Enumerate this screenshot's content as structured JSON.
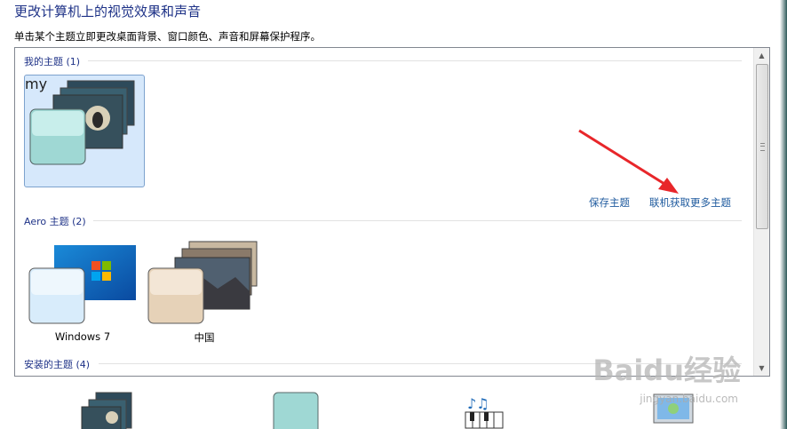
{
  "header": {
    "title": "更改计算机上的视觉效果和声音",
    "subtitle": "单击某个主题立即更改桌面背景、窗口颜色、声音和屏幕保护程序。"
  },
  "groups": {
    "my": {
      "header": "我的主题 (1)",
      "theme_name": "my"
    },
    "aero": {
      "header": "Aero 主题 (2)",
      "themes": [
        "Windows 7",
        "中国"
      ]
    },
    "installed": {
      "header": "安装的主题 (4)"
    }
  },
  "links": {
    "save": "保存主题",
    "online": "联机获取更多主题"
  },
  "watermark": {
    "brand": "Baidu经验",
    "url": "jingyan.baidu.com"
  },
  "colors": {
    "accent": "#1e3287",
    "link": "#1e5a9e",
    "selection": "#d6e8fb",
    "annotation_arrow": "#e8262a"
  }
}
